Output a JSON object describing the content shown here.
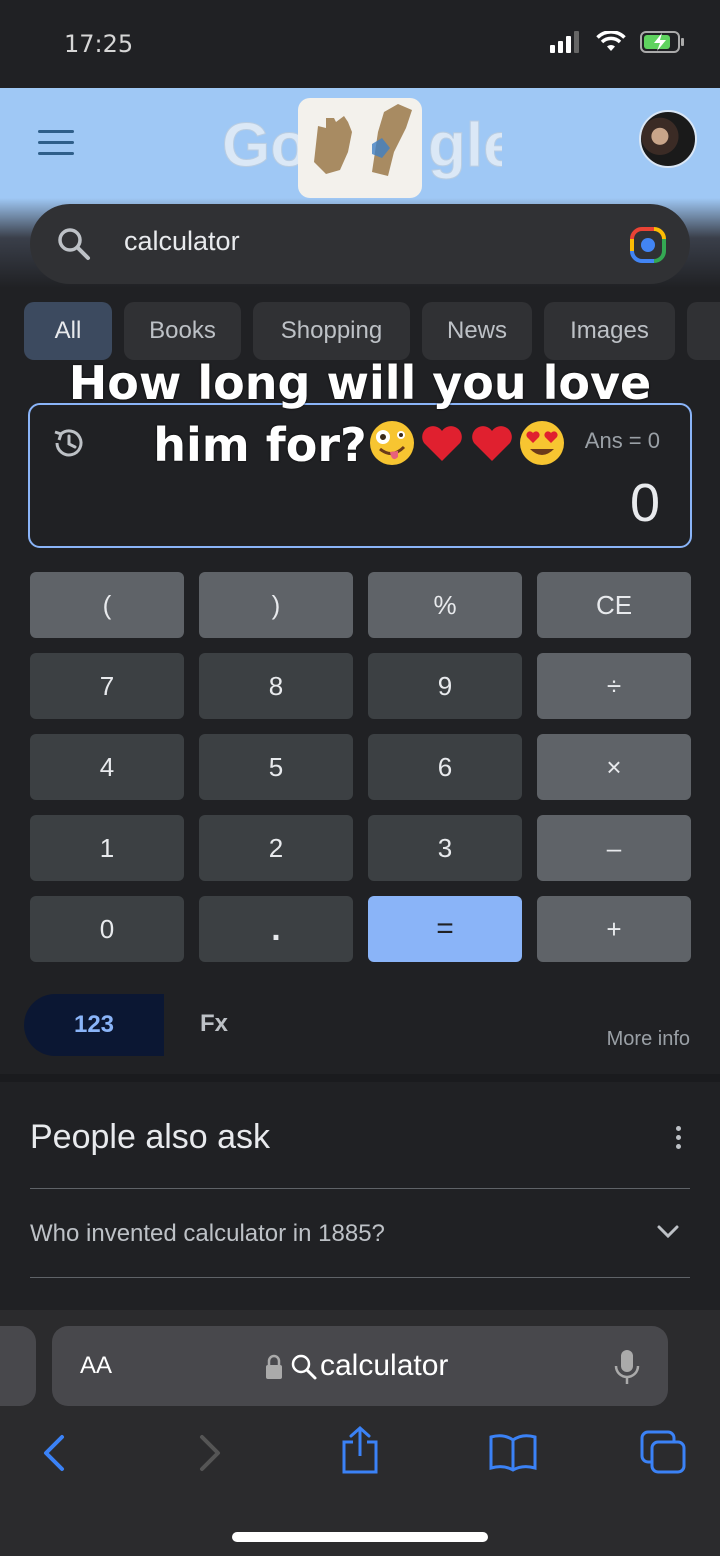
{
  "status_bar": {
    "time": "17:25"
  },
  "search": {
    "query": "calculator"
  },
  "tabs": [
    {
      "label": "All"
    },
    {
      "label": "Books"
    },
    {
      "label": "Shopping"
    },
    {
      "label": "News"
    },
    {
      "label": "Images"
    }
  ],
  "overlay": {
    "line1": "How long will you love",
    "line2": "him for?"
  },
  "calculator": {
    "ans_label": "Ans = 0",
    "result": "0",
    "keys": {
      "lparen": "(",
      "rparen": ")",
      "percent": "%",
      "ce": "CE",
      "k7": "7",
      "k8": "8",
      "k9": "9",
      "div": "÷",
      "k4": "4",
      "k5": "5",
      "k6": "6",
      "mul": "×",
      "k1": "1",
      "k2": "2",
      "k3": "3",
      "minus": "–",
      "k0": "0",
      "dot": ".",
      "eq": "=",
      "plus": "+"
    },
    "mode_basic": "123",
    "mode_fx": "Fx",
    "more_info": "More info"
  },
  "people_also_ask": {
    "title": "People also ask",
    "questions": [
      "Who invented calculator in 1885?"
    ]
  },
  "safari": {
    "aa": "AA",
    "url": "calculator"
  },
  "colors": {
    "accent": "#8ab4f8",
    "background": "#202124",
    "key": "#3c4043",
    "key_function": "#5f6368"
  }
}
